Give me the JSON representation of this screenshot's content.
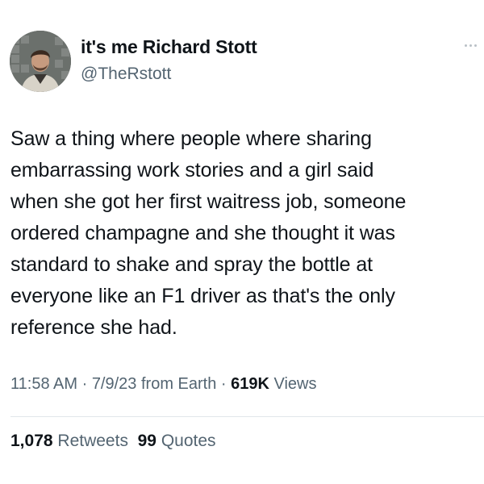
{
  "author": {
    "display_name": "it's me Richard Stott",
    "handle": "@TheRstott"
  },
  "tweet": {
    "text_lines": [
      "Saw a thing where people where sharing",
      "embarrassing work stories and a girl said",
      "when she got her first waitress job, someone",
      "ordered champagne and she thought it was",
      "standard to shake and spray the bottle at",
      "everyone like an F1 driver as that's the only",
      "reference she had."
    ]
  },
  "meta": {
    "time": "11:58 AM",
    "date": "7/9/23",
    "source": "from Earth",
    "separator": " · ",
    "views_count": "619K",
    "views_label": "Views"
  },
  "stats": {
    "retweets_count": "1,078",
    "retweets_label": "Retweets",
    "quotes_count": "99",
    "quotes_label": "Quotes"
  },
  "icons": {
    "more": "more-horizontal-icon"
  },
  "colors": {
    "text_primary": "#0f1419",
    "text_secondary": "#536471",
    "divider": "#e1e6ea"
  }
}
